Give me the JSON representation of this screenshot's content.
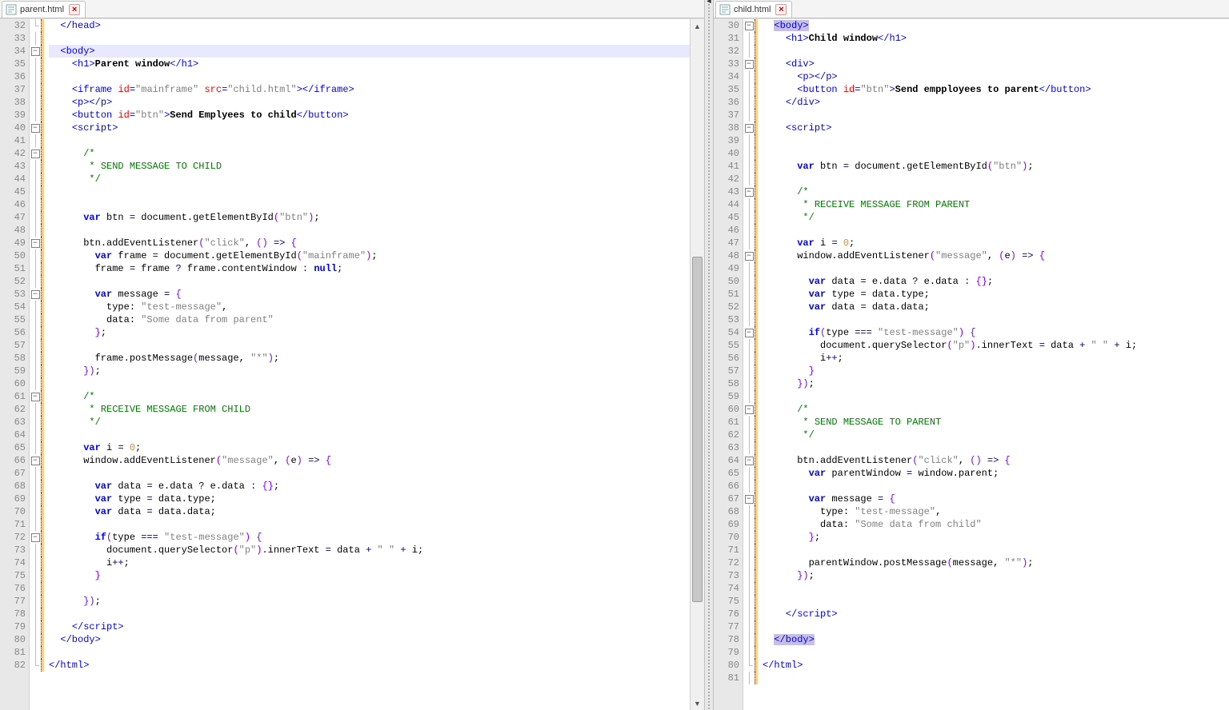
{
  "left": {
    "tab": {
      "title": "parent.html",
      "icon": "html-file-icon"
    },
    "startLine": 32,
    "highlightLine": 34,
    "scroll": {
      "thumbTop": 280,
      "thumbHeight": 430
    },
    "changedLines": [
      32,
      33,
      34,
      35,
      36,
      37,
      38,
      39,
      40,
      41,
      42,
      43,
      44,
      45,
      46,
      47,
      48,
      49,
      50,
      51,
      52,
      53,
      54,
      55,
      56,
      57,
      58,
      59,
      60,
      61,
      62,
      63,
      64,
      65,
      66,
      67,
      68,
      69,
      70,
      71,
      72,
      73,
      74,
      75,
      76,
      77,
      78,
      79,
      80,
      81,
      82
    ],
    "fold": {
      "32": "end",
      "34": "open",
      "40": "open",
      "42": "open",
      "44": "line",
      "49": "open",
      "53": "open",
      "56": "line",
      "59": "line",
      "61": "open",
      "63": "line",
      "66": "open",
      "72": "open",
      "75": "line",
      "77": "line",
      "79": "line",
      "80": "line",
      "82": "end"
    },
    "lines": [
      {
        "indent": 2,
        "html": "<span class='t-tag'>&lt;/head&gt;</span>"
      },
      {
        "indent": 0,
        "html": ""
      },
      {
        "indent": 2,
        "html": "<span class='t-tag'>&lt;body&gt;</span>"
      },
      {
        "indent": 4,
        "html": "<span class='t-tag'>&lt;h1&gt;</span><span class='t-text'>Parent window</span><span class='t-tag'>&lt;/h1&gt;</span>"
      },
      {
        "indent": 0,
        "html": ""
      },
      {
        "indent": 4,
        "html": "<span class='t-tag'>&lt;iframe</span> <span class='t-attr'>id</span><span class='t-tag'>=</span><span class='t-str'>\"mainframe\"</span> <span class='t-attr'>src</span><span class='t-tag'>=</span><span class='t-str'>\"child.html\"</span><span class='t-tag'>&gt;&lt;/iframe&gt;</span>"
      },
      {
        "indent": 4,
        "html": "<span class='t-tag'>&lt;p&gt;&lt;/p&gt;</span>"
      },
      {
        "indent": 4,
        "html": "<span class='t-tag'>&lt;button</span> <span class='t-attr'>id</span><span class='t-tag'>=</span><span class='t-str'>\"btn\"</span><span class='t-tag'>&gt;</span><span class='t-text'>Send Emplyees to child</span><span class='t-tag'>&lt;/button&gt;</span>"
      },
      {
        "indent": 4,
        "html": "<span class='t-tag'>&lt;script&gt;</span>"
      },
      {
        "indent": 0,
        "html": ""
      },
      {
        "indent": 6,
        "html": "<span class='t-cmt'>/*</span>"
      },
      {
        "indent": 6,
        "html": "<span class='t-cmt'> * SEND MESSAGE TO CHILD</span>"
      },
      {
        "indent": 6,
        "html": "<span class='t-cmt'> */</span>"
      },
      {
        "indent": 0,
        "html": ""
      },
      {
        "indent": 0,
        "html": ""
      },
      {
        "indent": 6,
        "html": "<span class='t-kw'>var</span> btn <span class='t-op'>=</span> document<span class='t-punc'>.</span>getElementById<span class='t-brace'>(</span><span class='t-str'>\"btn\"</span><span class='t-brace'>)</span><span class='t-punc'>;</span>"
      },
      {
        "indent": 0,
        "html": ""
      },
      {
        "indent": 6,
        "html": "btn<span class='t-punc'>.</span>addEventListener<span class='t-brace'>(</span><span class='t-str'>\"click\"</span><span class='t-punc'>,</span> <span class='t-brace'>()</span> <span class='t-op'>=&gt;</span> <span class='t-brace'>{</span>"
      },
      {
        "indent": 8,
        "html": "<span class='t-kw'>var</span> frame <span class='t-op'>=</span> document<span class='t-punc'>.</span>getElementById<span class='t-brace'>(</span><span class='t-str'>\"mainframe\"</span><span class='t-brace'>)</span><span class='t-punc'>;</span>"
      },
      {
        "indent": 8,
        "html": "frame <span class='t-op'>=</span> frame <span class='t-op'>?</span> frame<span class='t-punc'>.</span>contentWindow <span class='t-op'>:</span> <span class='t-kw'>null</span><span class='t-punc'>;</span>"
      },
      {
        "indent": 0,
        "html": ""
      },
      {
        "indent": 8,
        "html": "<span class='t-kw'>var</span> message <span class='t-op'>=</span> <span class='t-brace'>{</span>"
      },
      {
        "indent": 10,
        "html": "type<span class='t-punc'>:</span> <span class='t-str'>\"test-message\"</span><span class='t-punc'>,</span>"
      },
      {
        "indent": 10,
        "html": "data<span class='t-punc'>:</span> <span class='t-str'>\"Some data from parent\"</span>"
      },
      {
        "indent": 8,
        "html": "<span class='t-brace'>}</span><span class='t-punc'>;</span>"
      },
      {
        "indent": 0,
        "html": ""
      },
      {
        "indent": 8,
        "html": "frame<span class='t-punc'>.</span>postMessage<span class='t-brace'>(</span>message<span class='t-punc'>,</span> <span class='t-str'>\"*\"</span><span class='t-brace'>)</span><span class='t-punc'>;</span>"
      },
      {
        "indent": 6,
        "html": "<span class='t-brace'>})</span><span class='t-punc'>;</span>"
      },
      {
        "indent": 0,
        "html": ""
      },
      {
        "indent": 6,
        "html": "<span class='t-cmt'>/*</span>"
      },
      {
        "indent": 6,
        "html": "<span class='t-cmt'> * RECEIVE MESSAGE FROM CHILD</span>"
      },
      {
        "indent": 6,
        "html": "<span class='t-cmt'> */</span>"
      },
      {
        "indent": 0,
        "html": ""
      },
      {
        "indent": 6,
        "html": "<span class='t-kw'>var</span> i <span class='t-op'>=</span> <span class='t-num'>0</span><span class='t-punc'>;</span>"
      },
      {
        "indent": 6,
        "html": "window<span class='t-punc'>.</span>addEventListener<span class='t-brace'>(</span><span class='t-str'>\"message\"</span><span class='t-punc'>,</span> <span class='t-brace'>(</span>e<span class='t-brace'>)</span> <span class='t-op'>=&gt;</span> <span class='t-brace'>{</span>"
      },
      {
        "indent": 0,
        "html": ""
      },
      {
        "indent": 8,
        "html": "<span class='t-kw'>var</span> data <span class='t-op'>=</span> e<span class='t-punc'>.</span>data <span class='t-op'>?</span> e<span class='t-punc'>.</span>data <span class='t-op'>:</span> <span class='t-brace'>{}</span><span class='t-punc'>;</span>"
      },
      {
        "indent": 8,
        "html": "<span class='t-kw'>var</span> type <span class='t-op'>=</span> data<span class='t-punc'>.</span>type<span class='t-punc'>;</span>"
      },
      {
        "indent": 8,
        "html": "<span class='t-kw'>var</span> data <span class='t-op'>=</span> data<span class='t-punc'>.</span>data<span class='t-punc'>;</span>"
      },
      {
        "indent": 0,
        "html": ""
      },
      {
        "indent": 8,
        "html": "<span class='t-kw'>if</span><span class='t-brace'>(</span>type <span class='t-op'>===</span> <span class='t-str'>\"test-message\"</span><span class='t-brace'>)</span> <span class='t-brace'>{</span>"
      },
      {
        "indent": 10,
        "html": "document<span class='t-punc'>.</span>querySelector<span class='t-brace'>(</span><span class='t-str'>\"p\"</span><span class='t-brace'>)</span><span class='t-punc'>.</span>innerText <span class='t-op'>=</span> data <span class='t-op'>+</span> <span class='t-str'>\" \"</span> <span class='t-op'>+</span> i<span class='t-punc'>;</span>"
      },
      {
        "indent": 10,
        "html": "i<span class='t-op'>++</span><span class='t-punc'>;</span>"
      },
      {
        "indent": 8,
        "html": "<span class='t-brace'>}</span>"
      },
      {
        "indent": 0,
        "html": ""
      },
      {
        "indent": 6,
        "html": "<span class='t-brace'>})</span><span class='t-punc'>;</span>"
      },
      {
        "indent": 0,
        "html": ""
      },
      {
        "indent": 4,
        "html": "<span class='t-tag'>&lt;/script&gt;</span>"
      },
      {
        "indent": 2,
        "html": "<span class='t-tag'>&lt;/body&gt;</span>"
      },
      {
        "indent": 0,
        "html": ""
      },
      {
        "indent": 0,
        "html": "<span class='t-tag'>&lt;/html&gt;</span>"
      }
    ]
  },
  "right": {
    "tab": {
      "title": "child.html",
      "icon": "html-file-icon"
    },
    "startLine": 30,
    "selection": {
      "from": 30,
      "to": 78
    },
    "changedLines": [
      30,
      31,
      32,
      33,
      34,
      35,
      36,
      37,
      38,
      39,
      40,
      41,
      42,
      43,
      44,
      45,
      46,
      47,
      48,
      49,
      50,
      51,
      52,
      53,
      54,
      55,
      56,
      57,
      58,
      59,
      60,
      61,
      62,
      63,
      64,
      65,
      66,
      67,
      68,
      69,
      70,
      71,
      72,
      73,
      74,
      75,
      76,
      77,
      78,
      79,
      80,
      81
    ],
    "fold": {
      "30": "open",
      "33": "open",
      "36": "line",
      "38": "open",
      "43": "open",
      "45": "line",
      "48": "open",
      "50": "line",
      "54": "open",
      "57": "line",
      "58": "line",
      "60": "open",
      "62": "line",
      "64": "open",
      "67": "open",
      "70": "line",
      "73": "line",
      "76": "line",
      "78": "line",
      "80": "end"
    },
    "lines": [
      {
        "indent": 2,
        "html": "<span class='hl-sel'><span class='t-tag'>&lt;body&gt;</span></span>"
      },
      {
        "indent": 4,
        "html": "<span class='t-tag'>&lt;h1&gt;</span><span class='t-text'>Child window</span><span class='t-tag'>&lt;/h1&gt;</span>"
      },
      {
        "indent": 0,
        "html": ""
      },
      {
        "indent": 4,
        "html": "<span class='t-tag'>&lt;div&gt;</span>"
      },
      {
        "indent": 6,
        "html": "<span class='t-tag'>&lt;p&gt;&lt;/p&gt;</span>"
      },
      {
        "indent": 6,
        "html": "<span class='t-tag'>&lt;button</span> <span class='t-attr'>id</span><span class='t-tag'>=</span><span class='t-str'>\"btn\"</span><span class='t-tag'>&gt;</span><span class='t-text'>Send empployees to parent</span><span class='t-tag'>&lt;/button&gt;</span>"
      },
      {
        "indent": 4,
        "html": "<span class='t-tag'>&lt;/div&gt;</span>"
      },
      {
        "indent": 0,
        "html": ""
      },
      {
        "indent": 4,
        "html": "<span class='t-tag'>&lt;script&gt;</span>"
      },
      {
        "indent": 0,
        "html": ""
      },
      {
        "indent": 0,
        "html": ""
      },
      {
        "indent": 6,
        "html": "<span class='t-kw'>var</span> btn <span class='t-op'>=</span> document<span class='t-punc'>.</span>getElementById<span class='t-brace'>(</span><span class='t-str'>\"btn\"</span><span class='t-brace'>)</span><span class='t-punc'>;</span>"
      },
      {
        "indent": 0,
        "html": ""
      },
      {
        "indent": 6,
        "html": "<span class='t-cmt'>/*</span>"
      },
      {
        "indent": 6,
        "html": "<span class='t-cmt'> * RECEIVE MESSAGE FROM PARENT</span>"
      },
      {
        "indent": 6,
        "html": "<span class='t-cmt'> */</span>"
      },
      {
        "indent": 0,
        "html": ""
      },
      {
        "indent": 6,
        "html": "<span class='t-kw'>var</span> i <span class='t-op'>=</span> <span class='t-num'>0</span><span class='t-punc'>;</span>"
      },
      {
        "indent": 6,
        "html": "window<span class='t-punc'>.</span>addEventListener<span class='t-brace'>(</span><span class='t-str'>\"message\"</span><span class='t-punc'>,</span> <span class='t-brace'>(</span>e<span class='t-brace'>)</span> <span class='t-op'>=&gt;</span> <span class='t-brace'>{</span>"
      },
      {
        "indent": 0,
        "html": ""
      },
      {
        "indent": 8,
        "html": "<span class='t-kw'>var</span> data <span class='t-op'>=</span> e<span class='t-punc'>.</span>data <span class='t-op'>?</span> e<span class='t-punc'>.</span>data <span class='t-op'>:</span> <span class='t-brace'>{}</span><span class='t-punc'>;</span>"
      },
      {
        "indent": 8,
        "html": "<span class='t-kw'>var</span> type <span class='t-op'>=</span> data<span class='t-punc'>.</span>type<span class='t-punc'>;</span>"
      },
      {
        "indent": 8,
        "html": "<span class='t-kw'>var</span> data <span class='t-op'>=</span> data<span class='t-punc'>.</span>data<span class='t-punc'>;</span>"
      },
      {
        "indent": 0,
        "html": ""
      },
      {
        "indent": 8,
        "html": "<span class='t-kw'>if</span><span class='t-brace'>(</span>type <span class='t-op'>===</span> <span class='t-str'>\"test-message\"</span><span class='t-brace'>)</span> <span class='t-brace'>{</span>"
      },
      {
        "indent": 10,
        "html": "document<span class='t-punc'>.</span>querySelector<span class='t-brace'>(</span><span class='t-str'>\"p\"</span><span class='t-brace'>)</span><span class='t-punc'>.</span>innerText <span class='t-op'>=</span> data <span class='t-op'>+</span> <span class='t-str'>\" \"</span> <span class='t-op'>+</span> i<span class='t-punc'>;</span>"
      },
      {
        "indent": 10,
        "html": "i<span class='t-op'>++</span><span class='t-punc'>;</span>"
      },
      {
        "indent": 8,
        "html": "<span class='t-brace'>}</span>"
      },
      {
        "indent": 6,
        "html": "<span class='t-brace'>})</span><span class='t-punc'>;</span>"
      },
      {
        "indent": 0,
        "html": ""
      },
      {
        "indent": 6,
        "html": "<span class='t-cmt'>/*</span>"
      },
      {
        "indent": 6,
        "html": "<span class='t-cmt'> * SEND MESSAGE TO PARENT</span>"
      },
      {
        "indent": 6,
        "html": "<span class='t-cmt'> */</span>"
      },
      {
        "indent": 0,
        "html": ""
      },
      {
        "indent": 6,
        "html": "btn<span class='t-punc'>.</span>addEventListener<span class='t-brace'>(</span><span class='t-str'>\"click\"</span><span class='t-punc'>,</span> <span class='t-brace'>()</span> <span class='t-op'>=&gt;</span> <span class='t-brace'>{</span>"
      },
      {
        "indent": 8,
        "html": "<span class='t-kw'>var</span> parentWindow <span class='t-op'>=</span> window<span class='t-punc'>.</span>parent<span class='t-punc'>;</span>"
      },
      {
        "indent": 0,
        "html": ""
      },
      {
        "indent": 8,
        "html": "<span class='t-kw'>var</span> message <span class='t-op'>=</span> <span class='t-brace'>{</span>"
      },
      {
        "indent": 10,
        "html": "type<span class='t-punc'>:</span> <span class='t-str'>\"test-message\"</span><span class='t-punc'>,</span>"
      },
      {
        "indent": 10,
        "html": "data<span class='t-punc'>:</span> <span class='t-str'>\"Some data from child\"</span>"
      },
      {
        "indent": 8,
        "html": "<span class='t-brace'>}</span><span class='t-punc'>;</span>"
      },
      {
        "indent": 0,
        "html": ""
      },
      {
        "indent": 8,
        "html": "parentWindow<span class='t-punc'>.</span>postMessage<span class='t-brace'>(</span>message<span class='t-punc'>,</span> <span class='t-str'>\"*\"</span><span class='t-brace'>)</span><span class='t-punc'>;</span>"
      },
      {
        "indent": 6,
        "html": "<span class='t-brace'>})</span><span class='t-punc'>;</span>"
      },
      {
        "indent": 0,
        "html": ""
      },
      {
        "indent": 0,
        "html": ""
      },
      {
        "indent": 4,
        "html": "<span class='t-tag'>&lt;/script&gt;</span>"
      },
      {
        "indent": 0,
        "html": ""
      },
      {
        "indent": 2,
        "html": "<span class='hl-sel'><span class='t-tag'>&lt;/body&gt;</span></span>"
      },
      {
        "indent": 0,
        "html": ""
      },
      {
        "indent": 0,
        "html": "<span class='t-tag'>&lt;/html&gt;</span>"
      },
      {
        "indent": 0,
        "html": ""
      }
    ]
  }
}
